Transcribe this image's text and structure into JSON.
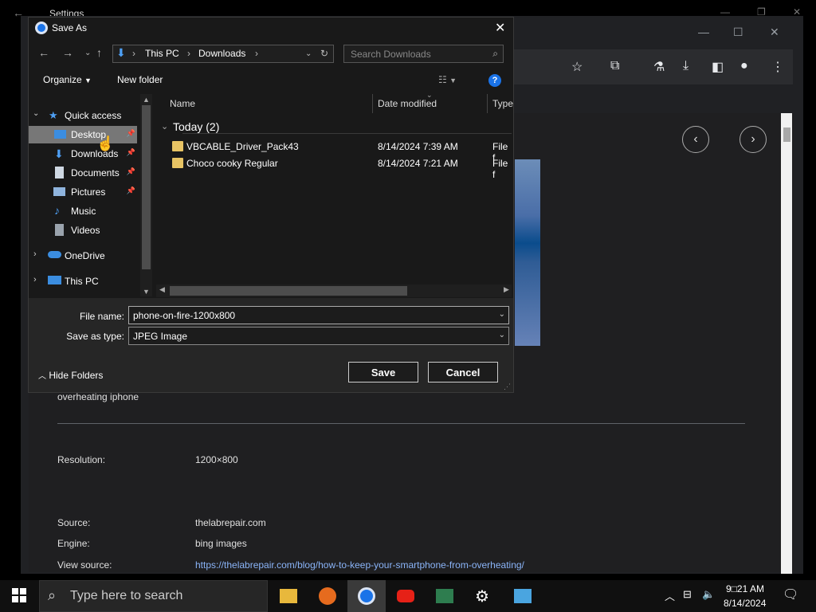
{
  "settings": {
    "title": "Settings"
  },
  "dialog": {
    "title": "Save As",
    "breadcrumb": [
      "This PC",
      "Downloads"
    ],
    "search_placeholder": "Search Downloads",
    "toolbar": {
      "organize": "Organize",
      "new_folder": "New folder"
    },
    "nav": [
      {
        "label": "Quick access",
        "icon": "star-icon"
      },
      {
        "label": "Desktop",
        "icon": "desktop-icon",
        "pinned": true,
        "selected": true
      },
      {
        "label": "Downloads",
        "icon": "download-arrow-icon",
        "pinned": true
      },
      {
        "label": "Documents",
        "icon": "document-icon",
        "pinned": true
      },
      {
        "label": "Pictures",
        "icon": "pictures-icon",
        "pinned": true
      },
      {
        "label": "Music",
        "icon": "music-icon"
      },
      {
        "label": "Videos",
        "icon": "videos-icon"
      },
      {
        "label": "OneDrive",
        "icon": "cloud-icon"
      },
      {
        "label": "This PC",
        "icon": "computer-icon"
      }
    ],
    "columns": {
      "name": "Name",
      "date": "Date modified",
      "type": "Type"
    },
    "group": "Today (2)",
    "files": [
      {
        "name": "VBCABLE_Driver_Pack43",
        "date": "8/14/2024 7:39 AM",
        "type": "File f"
      },
      {
        "name": "Choco cooky Regular",
        "date": "8/14/2024 7:21 AM",
        "type": "File f"
      }
    ],
    "file_name_label": "File name:",
    "file_name_value": "phone-on-fire-1200x800",
    "save_type_label": "Save as type:",
    "save_type_value": "JPEG Image",
    "hide_folders": "Hide Folders",
    "save": "Save",
    "cancel": "Cancel"
  },
  "viewer": {
    "caption": "overheating iphone",
    "resolution_label": "Resolution:",
    "resolution_value": "1200×800",
    "source_label": "Source:",
    "source_value": "thelabrepair.com",
    "engine_label": "Engine:",
    "engine_value": "bing images",
    "view_source_label": "View source:",
    "view_source_url": "https://thelabrepair.com/blog/how-to-keep-your-smartphone-from-overheating/"
  },
  "taskbar": {
    "search_placeholder": "Type here to search",
    "time": "9□21 AM",
    "date": "8/14/2024"
  },
  "colors": {
    "accent": "#1a73e8",
    "link": "#8ab4f8",
    "folder": "#e8c464",
    "selection": "#777777"
  }
}
